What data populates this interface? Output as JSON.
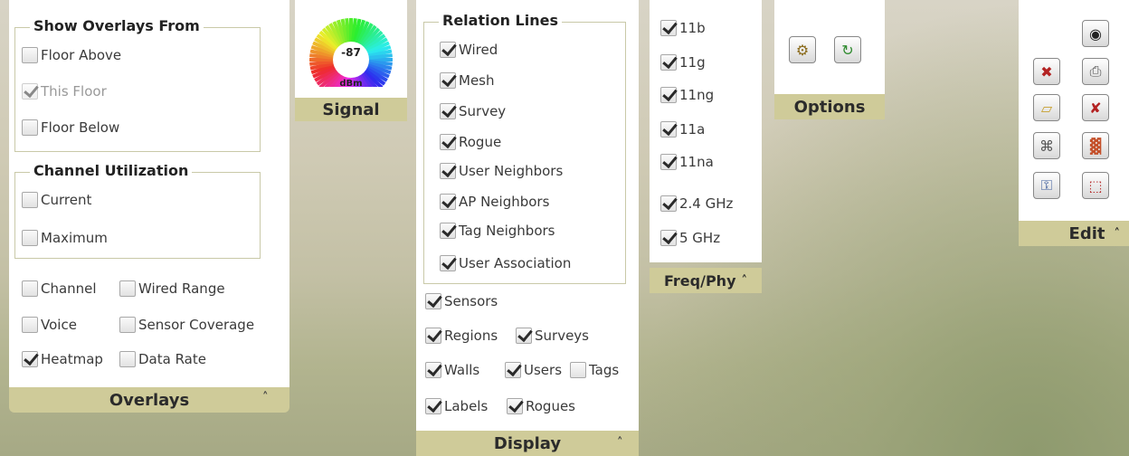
{
  "overlays": {
    "show_from_title": "Show Overlays From",
    "show_from_items": [
      {
        "label": "Floor Above",
        "checked": false,
        "disabled": false
      },
      {
        "label": "This Floor",
        "checked": true,
        "disabled": true
      },
      {
        "label": "Floor Below",
        "checked": false,
        "disabled": false
      }
    ],
    "channel_util_title": "Channel Utilization",
    "channel_util_items": [
      {
        "label": "Current",
        "checked": false
      },
      {
        "label": "Maximum",
        "checked": false
      }
    ],
    "grid_items": [
      {
        "label": "Channel",
        "checked": false
      },
      {
        "label": "Wired Range",
        "checked": false
      },
      {
        "label": "Voice",
        "checked": false
      },
      {
        "label": "Sensor Coverage",
        "checked": false
      },
      {
        "label": "Heatmap",
        "checked": true
      },
      {
        "label": "Data Rate",
        "checked": false
      }
    ],
    "footer": "Overlays",
    "collapse_glyph": "˄"
  },
  "signal": {
    "value": "-87",
    "unit": "dBm",
    "footer": "Signal"
  },
  "display": {
    "relation_title": "Relation Lines",
    "relation_items": [
      {
        "label": "Wired",
        "checked": true
      },
      {
        "label": "Mesh",
        "checked": true
      },
      {
        "label": "Survey",
        "checked": true
      },
      {
        "label": "Rogue",
        "checked": true
      },
      {
        "label": "User Neighbors",
        "checked": true
      },
      {
        "label": "AP Neighbors",
        "checked": true
      },
      {
        "label": "Tag Neighbors",
        "checked": true
      },
      {
        "label": "User Association",
        "checked": true
      }
    ],
    "other_items": {
      "sensors": {
        "label": "Sensors",
        "checked": true
      },
      "regions": {
        "label": "Regions",
        "checked": true
      },
      "surveys": {
        "label": "Surveys",
        "checked": true
      },
      "walls": {
        "label": "Walls",
        "checked": true
      },
      "users": {
        "label": "Users",
        "checked": true
      },
      "tags": {
        "label": "Tags",
        "checked": false
      },
      "labels": {
        "label": "Labels",
        "checked": true
      },
      "rogues": {
        "label": "Rogues",
        "checked": true
      }
    },
    "footer": "Display"
  },
  "freq": {
    "items": [
      {
        "label": "11b",
        "checked": true
      },
      {
        "label": "11g",
        "checked": true
      },
      {
        "label": "11ng",
        "checked": true
      },
      {
        "label": "11a",
        "checked": true
      },
      {
        "label": "11na",
        "checked": true
      },
      {
        "label": "2.4 GHz",
        "checked": true
      },
      {
        "label": "5 GHz",
        "checked": true
      }
    ],
    "footer": "Freq/Phy"
  },
  "options": {
    "footer": "Options",
    "buttons": [
      {
        "name": "options-settings-icon",
        "glyph": "⚙"
      },
      {
        "name": "options-refresh-icon",
        "glyph": "↻"
      }
    ]
  },
  "edit": {
    "footer": "Edit",
    "buttons": [
      {
        "name": "target-icon",
        "glyph": "◉"
      },
      {
        "name": "remove-ap-icon",
        "glyph": "✖"
      },
      {
        "name": "printer-icon",
        "glyph": "⎙"
      },
      {
        "name": "region-icon",
        "glyph": "▱"
      },
      {
        "name": "remove-device-icon",
        "glyph": "✘"
      },
      {
        "name": "device-icon",
        "glyph": "⌘"
      },
      {
        "name": "wall-icon",
        "glyph": "▓"
      },
      {
        "name": "unlock-icon",
        "glyph": "⚿"
      },
      {
        "name": "crop-icon",
        "glyph": "⬚"
      }
    ]
  }
}
